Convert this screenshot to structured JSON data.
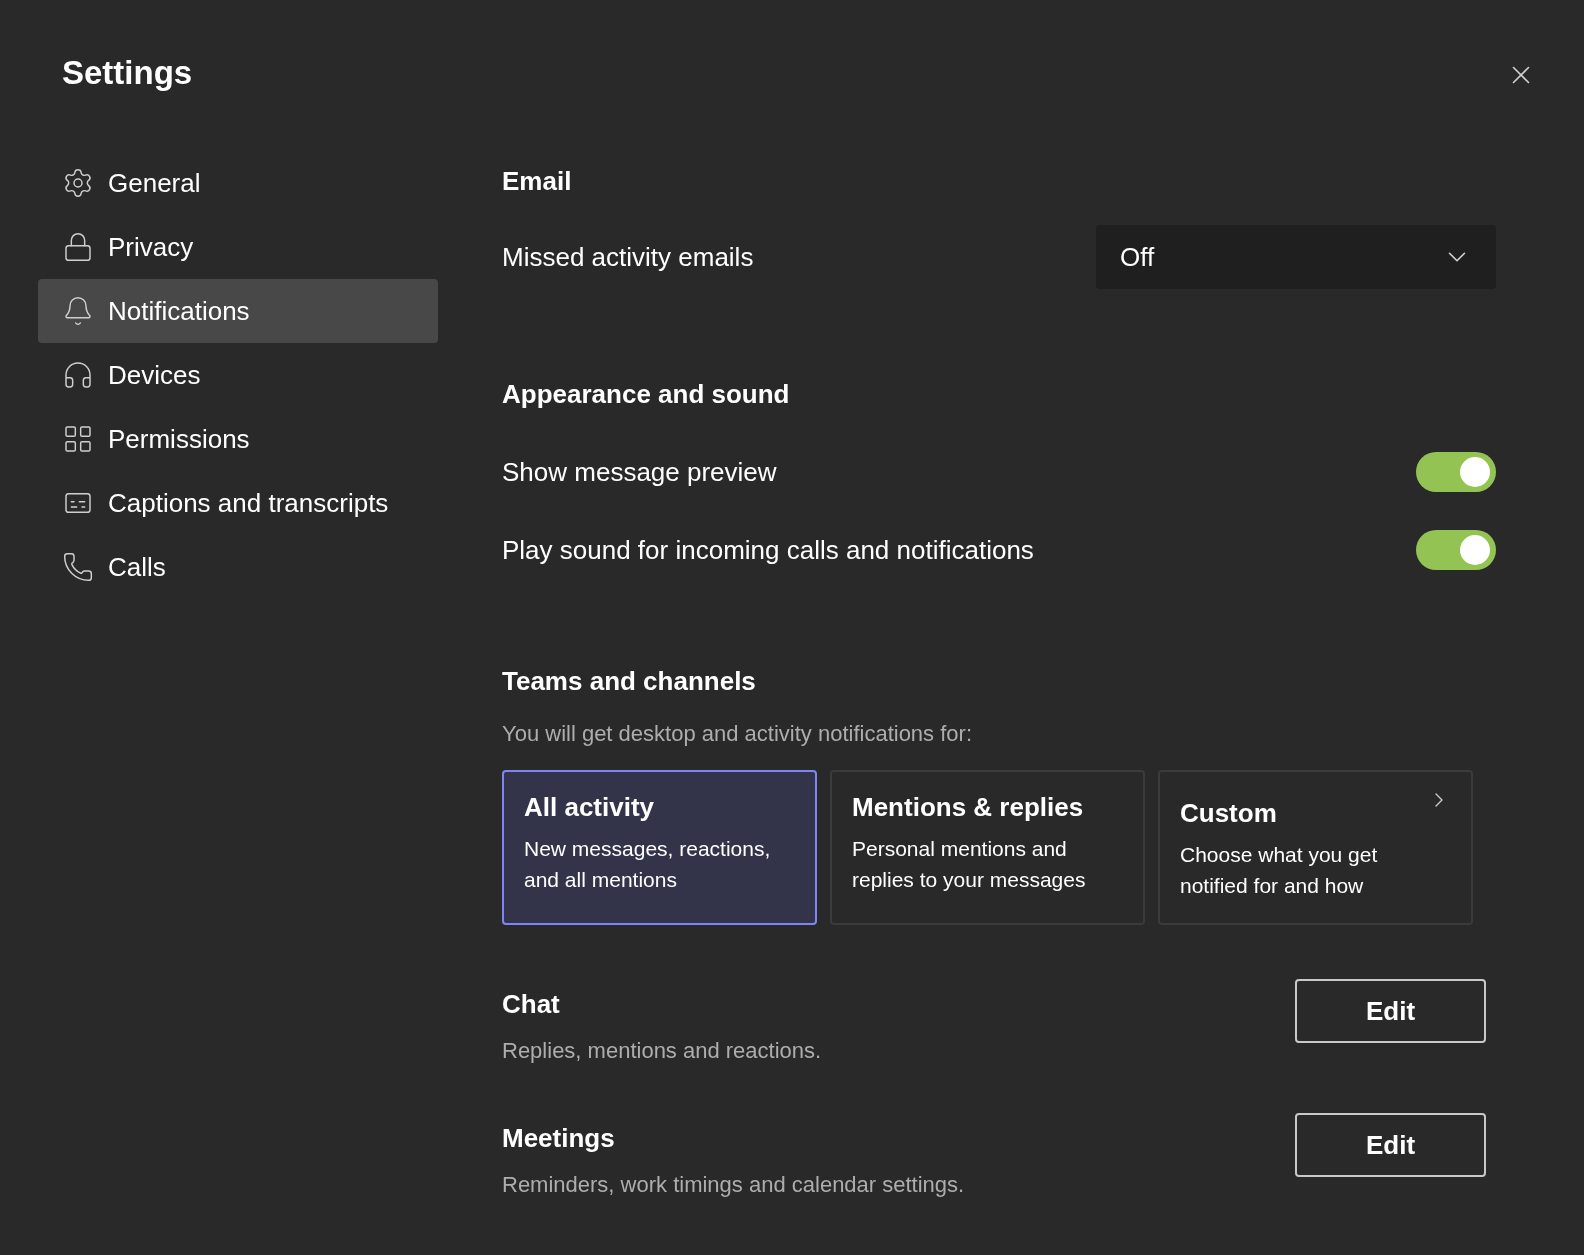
{
  "title": "Settings",
  "nav": [
    {
      "label": "General",
      "selected": false
    },
    {
      "label": "Privacy",
      "selected": false
    },
    {
      "label": "Notifications",
      "selected": true
    },
    {
      "label": "Devices",
      "selected": false
    },
    {
      "label": "Permissions",
      "selected": false
    },
    {
      "label": "Captions and transcripts",
      "selected": false
    },
    {
      "label": "Calls",
      "selected": false
    }
  ],
  "email": {
    "heading": "Email",
    "label": "Missed activity emails",
    "value": "Off"
  },
  "appearance": {
    "heading": "Appearance and sound",
    "toggles": [
      {
        "label": "Show message preview",
        "on": true
      },
      {
        "label": "Play sound for incoming calls and notifications",
        "on": true
      }
    ]
  },
  "teams": {
    "heading": "Teams and channels",
    "description": "You will get desktop and activity notifications for:",
    "options": [
      {
        "kind": "option",
        "title": "All activity",
        "description": "New messages, reactions, and all mentions",
        "selected": true
      },
      {
        "kind": "option",
        "title": "Mentions & replies",
        "description": "Personal mentions and replies to your messages",
        "selected": false
      },
      {
        "kind": "link",
        "title": "Custom",
        "description": "Choose what you get notified for and how",
        "selected": false
      }
    ]
  },
  "sections": [
    {
      "heading": "Chat",
      "description": "Replies, mentions and reactions.",
      "button": "Edit"
    },
    {
      "heading": "Meetings",
      "description": "Reminders, work timings and calendar settings.",
      "button": "Edit"
    }
  ]
}
